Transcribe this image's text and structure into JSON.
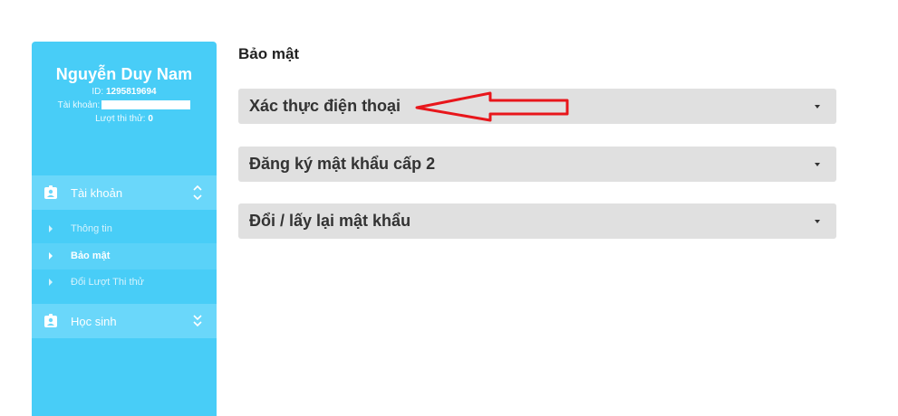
{
  "profile": {
    "name": "Nguyễn Duy Nam",
    "id_label": "ID:",
    "id_value": "1295819694",
    "account_label": "Tài khoản:",
    "turns_label": "Lượt thi thử:",
    "turns_value": "0"
  },
  "sidebar": {
    "groups": [
      {
        "label": "Tài khoản",
        "icon": "id-badge-icon",
        "expanded": true,
        "items": [
          {
            "label": "Thông tin",
            "active": false
          },
          {
            "label": "Bảo mật",
            "active": true
          },
          {
            "label": "Đổi Lượt Thi thử",
            "active": false
          }
        ]
      },
      {
        "label": "Học sinh",
        "icon": "id-badge-icon",
        "expanded": false
      }
    ]
  },
  "main": {
    "title": "Bảo mật",
    "sections": [
      {
        "label": "Xác thực điện thoại"
      },
      {
        "label": "Đăng ký mật khẩu cấp 2"
      },
      {
        "label": "Đổi / lấy lại mật khẩu"
      }
    ]
  },
  "colors": {
    "sidebar_bg": "#48cdf7",
    "accordion_bg": "#e0e0e0",
    "annotation_arrow": "#e8161b"
  }
}
